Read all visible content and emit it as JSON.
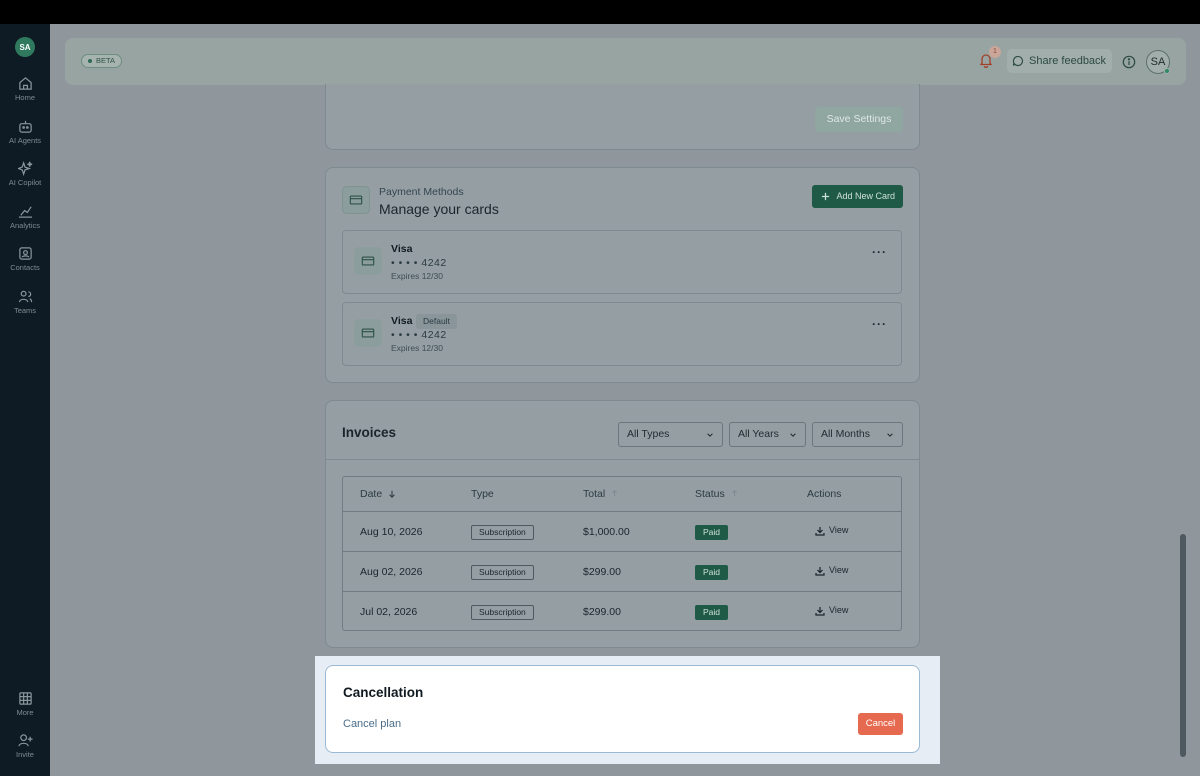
{
  "sidebar": {
    "avatar": "SA",
    "items": [
      {
        "label": "Home",
        "icon": "home-icon"
      },
      {
        "label": "AI Agents",
        "icon": "robot-icon"
      },
      {
        "label": "AI Copilot",
        "icon": "sparkle-icon"
      },
      {
        "label": "Analytics",
        "icon": "chart-icon"
      },
      {
        "label": "Contacts",
        "icon": "contact-icon"
      },
      {
        "label": "Teams",
        "icon": "team-icon"
      }
    ],
    "bottom": [
      {
        "label": "More",
        "icon": "grid-icon"
      },
      {
        "label": "Invite",
        "icon": "user-plus-icon"
      }
    ]
  },
  "header": {
    "beta": "BETA",
    "notification_count": "1",
    "feedback_label": "Share feedback",
    "avatar": "SA"
  },
  "settings": {
    "save_label": "Save Settings"
  },
  "payment_methods": {
    "subtitle": "Payment Methods",
    "title": "Manage your cards",
    "add_label": "Add New Card",
    "cards": [
      {
        "brand": "Visa",
        "number": "• • • •   4242",
        "expires": "Expires 12/30",
        "default": ""
      },
      {
        "brand": "Visa",
        "number": "• • • •   4242",
        "expires": "Expires 12/30",
        "default": "Default"
      }
    ]
  },
  "invoices": {
    "title": "Invoices",
    "filters": {
      "types": "All Types",
      "years": "All Years",
      "months": "All Months"
    },
    "columns": {
      "date": "Date",
      "type": "Type",
      "total": "Total",
      "status": "Status",
      "actions": "Actions"
    },
    "rows": [
      {
        "date": "Aug 10, 2026",
        "type": "Subscription",
        "total": "$1,000.00",
        "status": "Paid",
        "action": "View"
      },
      {
        "date": "Aug 02, 2026",
        "type": "Subscription",
        "total": "$299.00",
        "status": "Paid",
        "action": "View"
      },
      {
        "date": "Jul 02, 2026",
        "type": "Subscription",
        "total": "$299.00",
        "status": "Paid",
        "action": "View"
      }
    ]
  },
  "cancellation": {
    "title": "Cancellation",
    "link": "Cancel plan",
    "button": "Cancel"
  },
  "colors": {
    "accent": "#1f5a46",
    "danger": "#e66a4f",
    "sidebar": "#0f1b24"
  }
}
